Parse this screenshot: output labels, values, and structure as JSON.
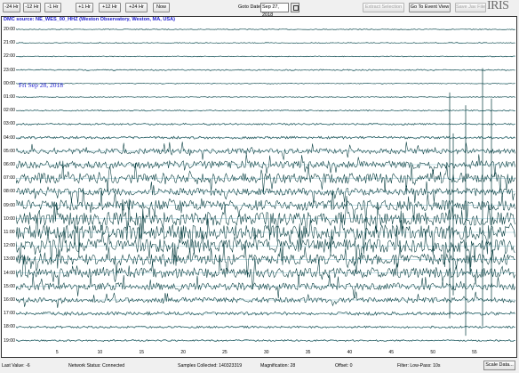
{
  "toolbar": {
    "minus24": "-24 Hr",
    "minus12": "-12 Hr",
    "minus1": "-1 Hr",
    "plus1": "+1 Hr",
    "plus12": "+12 Hr",
    "plus24": "+24 Hr",
    "now": "Now",
    "goto_label": "Goto Date:",
    "goto_value": "Sep 27, 2018",
    "extract": "Extract Selection",
    "event_view": "Go To Event View",
    "save": "Save Jav File"
  },
  "logo": "IRIS",
  "plot": {
    "title": "DMC source: NE_WES_00_HHZ (Weston Observatory, Weston, MA, USA)",
    "date_marker": "Fri Sep 28, 2018",
    "hours": [
      "20:00",
      "21:00",
      "22:00",
      "23:00",
      "00:00",
      "01:00",
      "02:00",
      "03:00",
      "04:00",
      "05:00",
      "06:00",
      "07:00",
      "08:00",
      "09:00",
      "10:00",
      "11:00",
      "12:00",
      "13:00",
      "14:00",
      "15:00",
      "16:00",
      "17:00",
      "18:00",
      "19:00"
    ],
    "minute_ticks": [
      "5",
      "10",
      "15",
      "20",
      "25",
      "30",
      "35",
      "40",
      "45",
      "50",
      "55"
    ],
    "trace_color": "#00383a",
    "gridline_color": "#3a9ab0"
  },
  "status": {
    "last_value": "Last Value:  -6",
    "network": "Network Status:  Connected",
    "samples": "Samples Collected:  140323319",
    "magnification": "Magnification:  28",
    "offset": "Offset:  0",
    "filter": "Filter:  Low-Pass: 10s",
    "scale_btn": "Scale Data..."
  }
}
